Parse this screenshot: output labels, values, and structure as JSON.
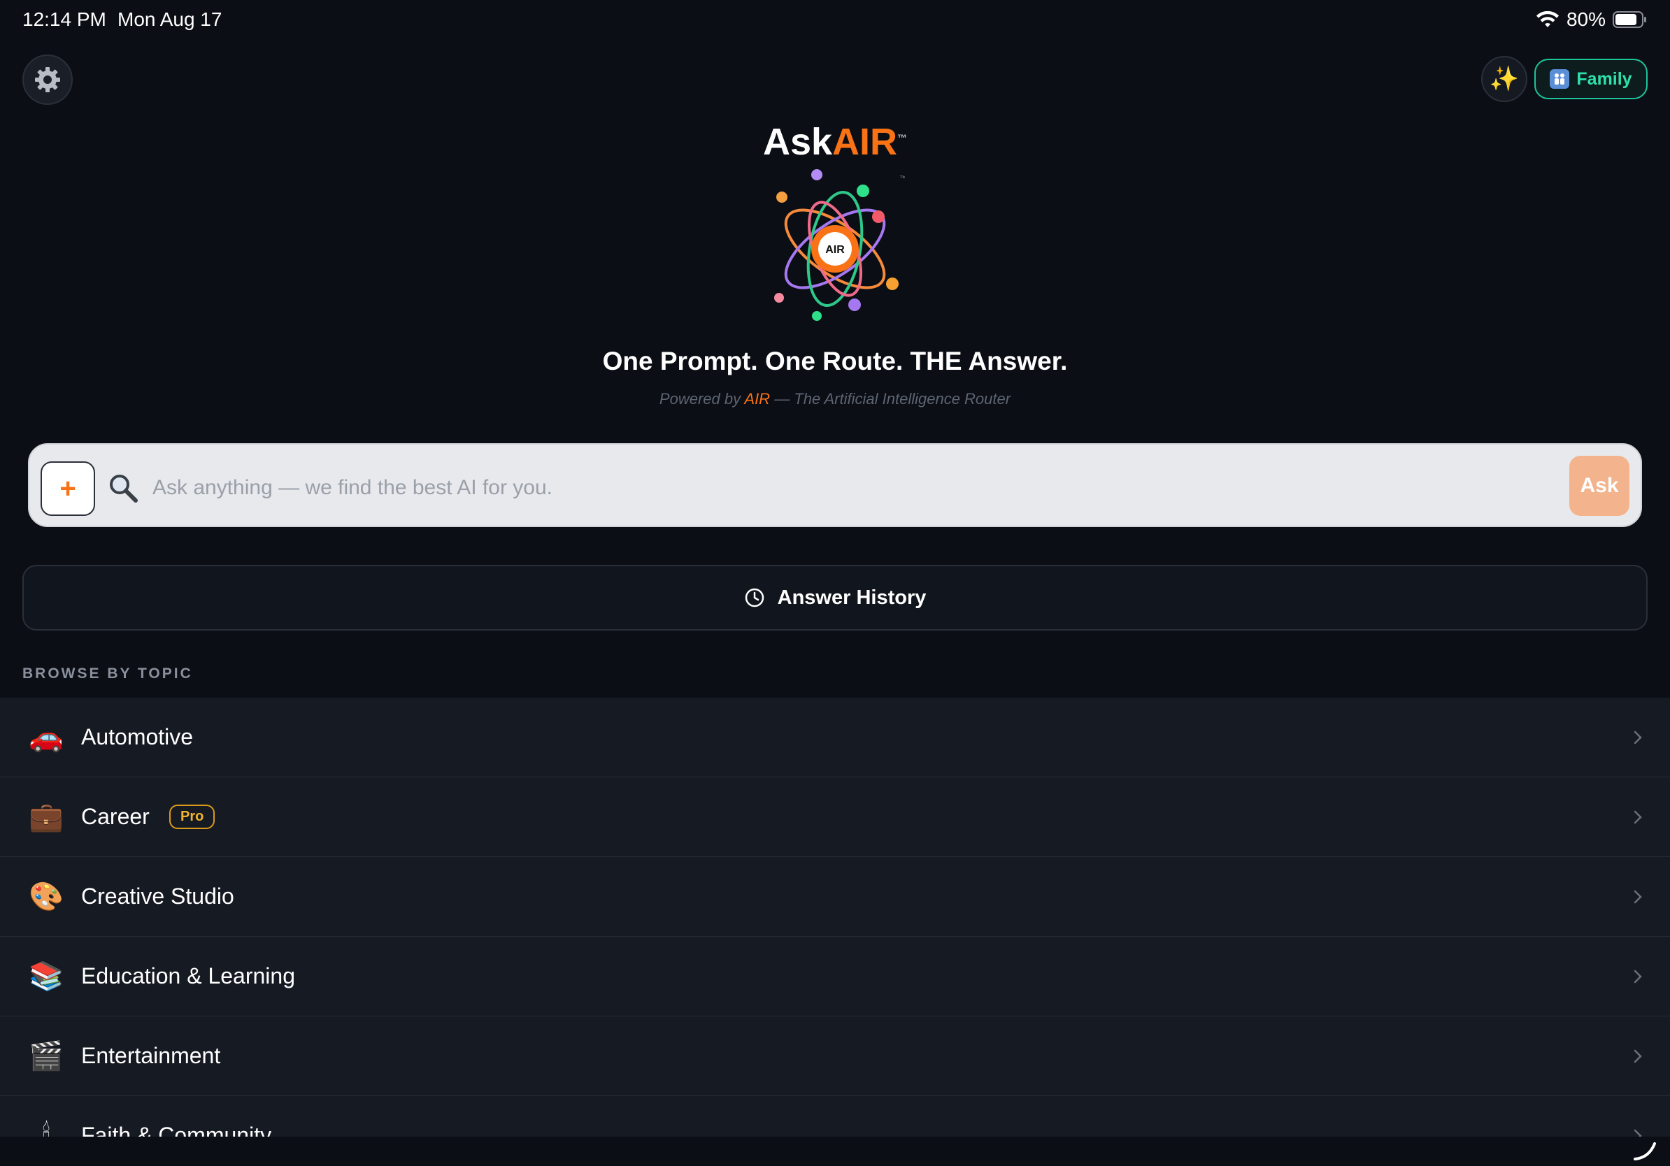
{
  "status_bar": {
    "time": "12:14 PM",
    "date": "Mon Aug 17",
    "battery": "80%"
  },
  "header": {
    "family_label": "Family",
    "sparkle_icon": "sparkles-icon",
    "settings_icon": "gear-icon"
  },
  "hero": {
    "brand_ask": "Ask",
    "brand_air": "AIR",
    "brand_tm": "™",
    "logo_tm": "™",
    "logo_center": "AIR",
    "tagline": "One Prompt. One Route. THE Answer.",
    "powered_prefix": "Powered by ",
    "powered_air": "AIR",
    "powered_suffix": " — The Artificial Intelligence Router"
  },
  "search": {
    "attach_label": "+",
    "placeholder": "Ask anything — we find the best AI for you.",
    "value": "",
    "ask_label": "Ask"
  },
  "history": {
    "label": "Answer History"
  },
  "browse": {
    "heading": "BROWSE BY TOPIC",
    "topics": [
      {
        "emoji": "🚗",
        "label": "Automotive"
      },
      {
        "emoji": "💼",
        "label": "Career",
        "badge": "Pro"
      },
      {
        "emoji": "🎨",
        "label": "Creative Studio"
      },
      {
        "emoji": "📚",
        "label": "Education & Learning"
      },
      {
        "emoji": "🎬",
        "label": "Entertainment"
      },
      {
        "emoji": "🕯",
        "label": "Faith & Community"
      }
    ]
  },
  "colors": {
    "accent_orange": "#f97316",
    "family_green": "#2ee0ac",
    "pro_gold": "#f0b32e",
    "background": "#0b0e14"
  }
}
